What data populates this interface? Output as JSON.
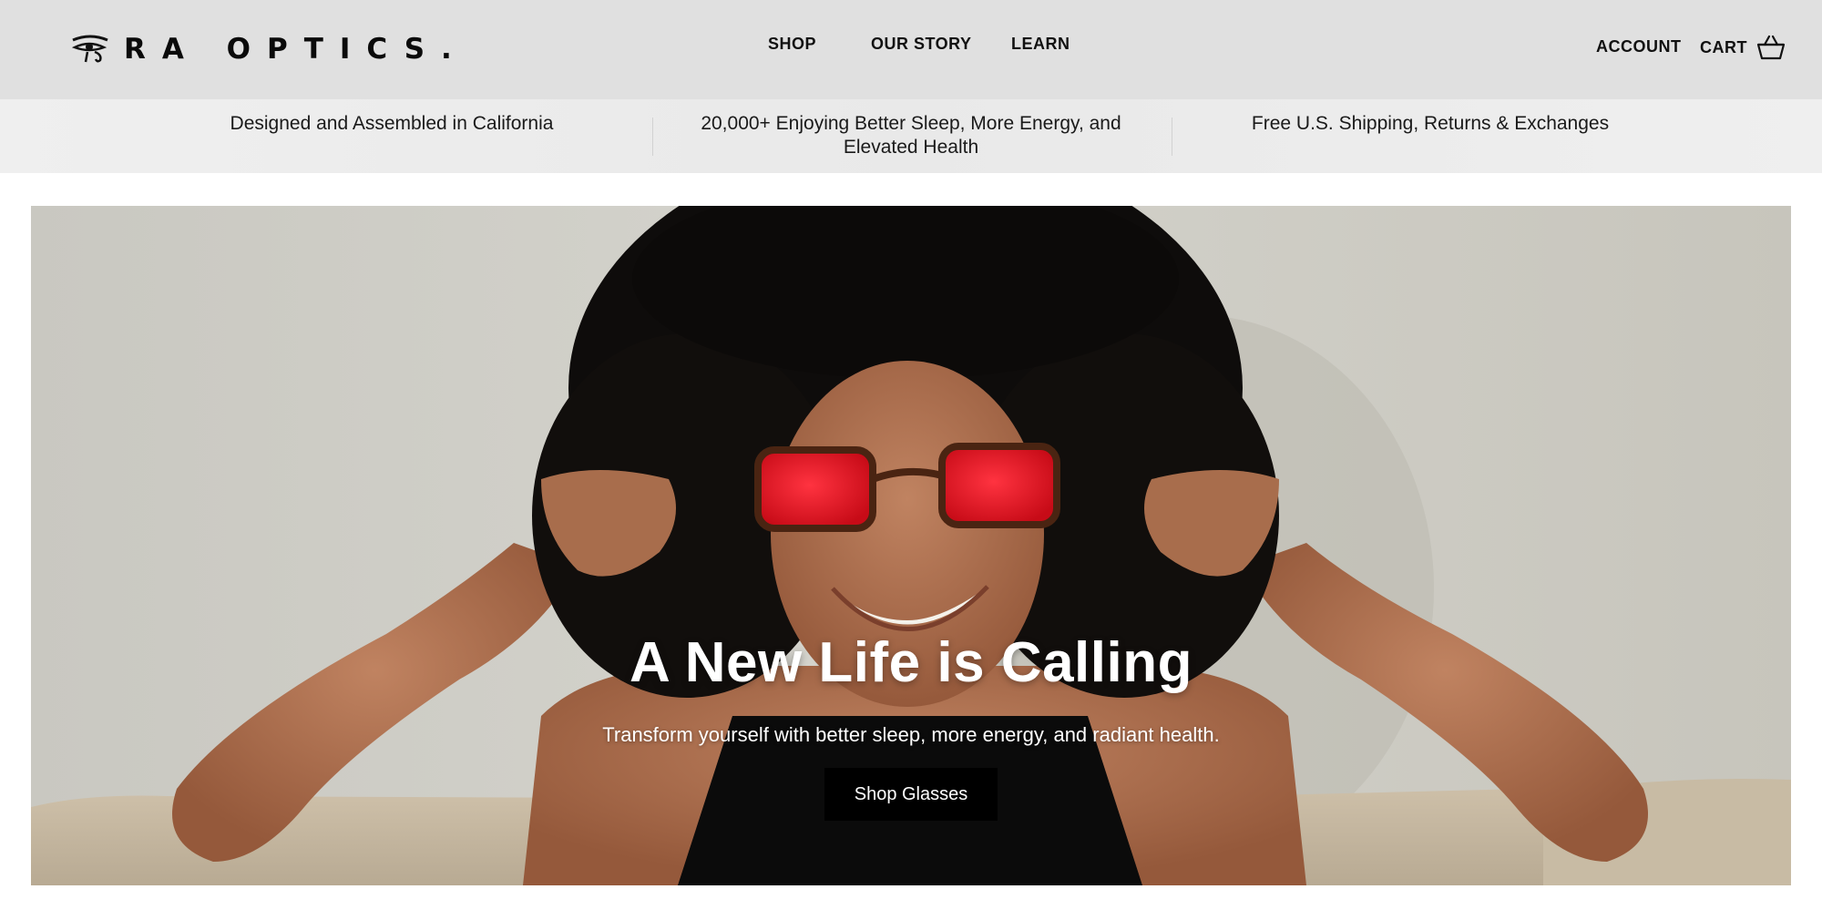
{
  "brand": {
    "name": "RA OPTICS.",
    "logo_icon": "eye-of-ra-icon"
  },
  "nav": {
    "items": [
      "SHOP",
      "OUR STORY",
      "LEARN"
    ]
  },
  "utility": {
    "account_label": "ACCOUNT",
    "cart_label": "CART",
    "cart_icon": "basket-icon"
  },
  "announcements": [
    "Designed and Assembled in California",
    "20,000+ Enjoying Better Sleep, More Energy, and Elevated Health",
    "Free U.S. Shipping, Returns & Exchanges"
  ],
  "hero": {
    "title": "A New Life is Calling",
    "subtitle": "Transform yourself with better sleep, more energy, and radiant health.",
    "button_label": "Shop Glasses",
    "lens_color": "#e0121f",
    "button_color": "#000000"
  }
}
